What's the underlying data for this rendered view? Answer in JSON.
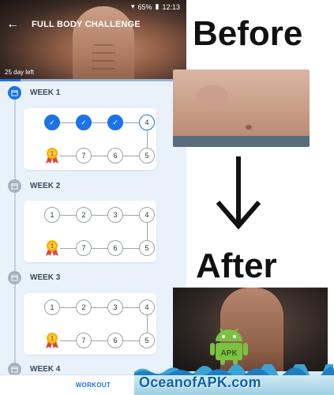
{
  "app": {
    "title": "FULL BODY CHALLENGE",
    "days_left": "25 day left",
    "progress": 0.11
  },
  "status_bar": {
    "battery": "65%",
    "time": "12:13"
  },
  "weeks": [
    {
      "label": "WEEK 1",
      "top_row": [
        {
          "text": "✓",
          "state": "done"
        },
        {
          "text": "✓",
          "state": "done"
        },
        {
          "text": "✓",
          "state": "done"
        },
        {
          "text": "4",
          "state": "current"
        }
      ],
      "bottom_row": [
        "7",
        "6",
        "5"
      ]
    },
    {
      "label": "WEEK 2",
      "top_row": [
        {
          "text": "1",
          "state": "todo"
        },
        {
          "text": "2",
          "state": "todo"
        },
        {
          "text": "3",
          "state": "todo"
        },
        {
          "text": "4",
          "state": "todo"
        }
      ],
      "bottom_row": [
        "7",
        "6",
        "5"
      ]
    },
    {
      "label": "WEEK 3",
      "top_row": [
        {
          "text": "1",
          "state": "todo"
        },
        {
          "text": "2",
          "state": "todo"
        },
        {
          "text": "3",
          "state": "todo"
        },
        {
          "text": "4",
          "state": "todo"
        }
      ],
      "bottom_row": [
        "7",
        "6",
        "5"
      ]
    },
    {
      "label": "WEEK 4"
    }
  ],
  "bottom_bar": {
    "workout_label": "WORKOUT"
  },
  "promo": {
    "before": "Before",
    "after": "After",
    "watermark": "OceanofAPK.com",
    "badge_text": "APK"
  },
  "colors": {
    "accent": "#1a73e8",
    "inactive": "#a7b2c1",
    "watermark": "#0b63a8"
  }
}
